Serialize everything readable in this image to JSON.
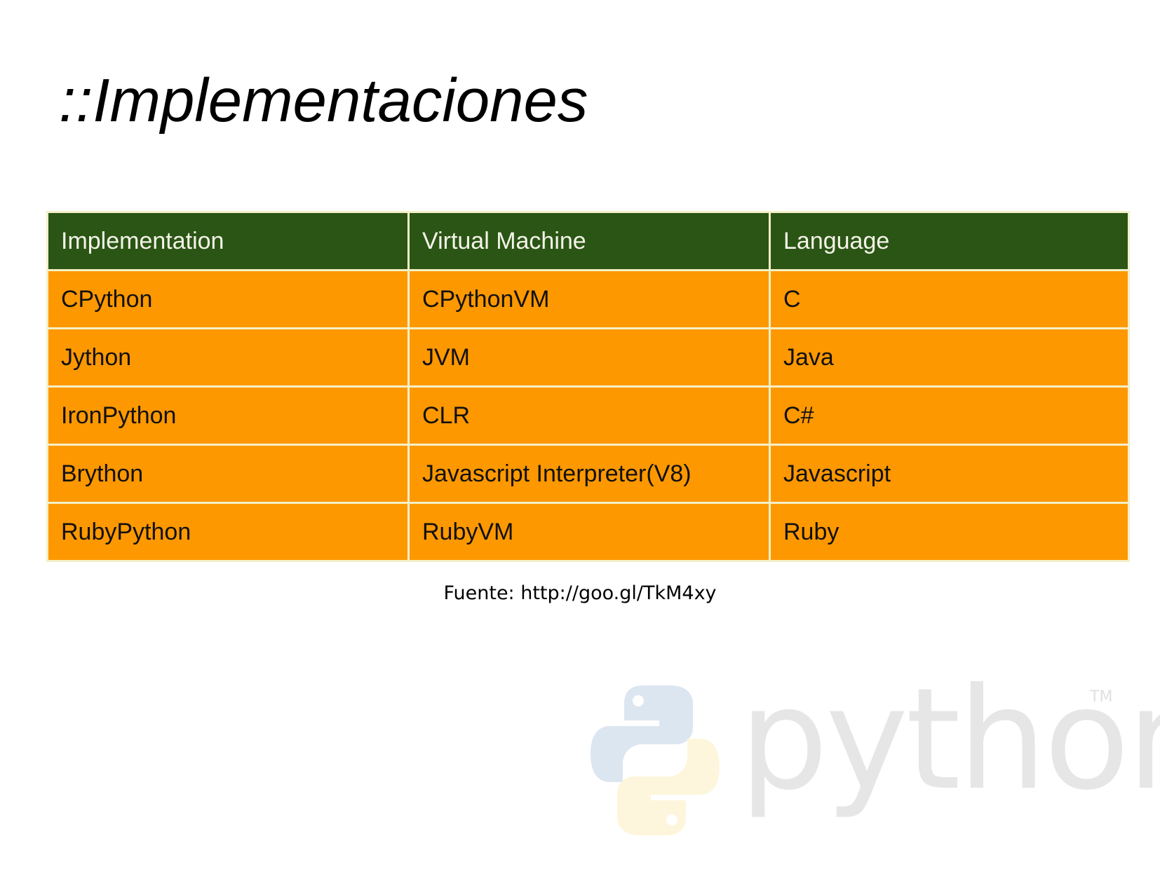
{
  "slide": {
    "title": "::Implementaciones"
  },
  "table": {
    "headers": [
      "Implementation",
      "Virtual Machine",
      "Language"
    ],
    "rows": [
      [
        "CPython",
        "CPythonVM",
        "C"
      ],
      [
        "Jython",
        "JVM",
        "Java"
      ],
      [
        "IronPython",
        "CLR",
        "C#"
      ],
      [
        "Brython",
        "Javascript Interpreter(V8)",
        "Javascript"
      ],
      [
        "RubyPython",
        "RubyVM",
        "Ruby"
      ]
    ]
  },
  "source": {
    "text": "Fuente: http://goo.gl/TkM4xy"
  },
  "logo": {
    "word": "python",
    "tm": "TM",
    "icon": "python-snakes-icon"
  },
  "colors": {
    "header_bg": "#2b5515",
    "header_text": "#f4f4e8",
    "cell_bg": "#fe9800",
    "grid": "#f3f0c8",
    "logo_blue": "#dce6f0",
    "logo_yellow": "#fdf6dc",
    "logo_gray": "#e6e6e6"
  }
}
